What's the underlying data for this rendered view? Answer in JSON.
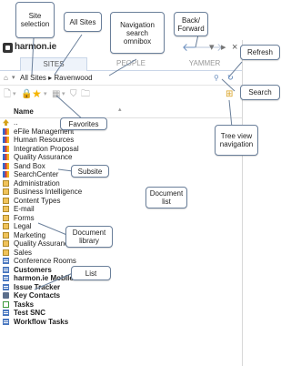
{
  "app": {
    "logo_text": "harmon.ie"
  },
  "window_controls": {
    "back": "🡐",
    "forward": "🡒",
    "menu": "▾",
    "pin": "▸",
    "close": "×"
  },
  "tabs": [
    {
      "label": "SITES",
      "active": true
    },
    {
      "label": "PEOPLE",
      "active": false
    },
    {
      "label": "YAMMER",
      "active": false
    }
  ],
  "address_bar": {
    "path": "All Sites ▸ Ravenwood",
    "refresh_symbol": "↻",
    "search_symbol": "⚲"
  },
  "list": {
    "column_header": "Name",
    "items": [
      {
        "name": "..",
        "icon": "up-folder-icon"
      },
      {
        "name": "eFile Management",
        "icon": "site-icon"
      },
      {
        "name": "Human Resources",
        "icon": "site-icon"
      },
      {
        "name": "Integration Proposal",
        "icon": "site-icon"
      },
      {
        "name": "Quality Assurance",
        "icon": "site-icon"
      },
      {
        "name": "Sand Box",
        "icon": "site-icon"
      },
      {
        "name": "SearchCenter",
        "icon": "site-icon"
      },
      {
        "name": "Administration",
        "icon": "library-icon"
      },
      {
        "name": "Business Intelligence",
        "icon": "library-icon"
      },
      {
        "name": "Content Types",
        "icon": "library-icon"
      },
      {
        "name": "E-mail",
        "icon": "library-icon"
      },
      {
        "name": "Forms",
        "icon": "library-icon"
      },
      {
        "name": "Legal",
        "icon": "library-icon"
      },
      {
        "name": "Marketing",
        "icon": "library-icon"
      },
      {
        "name": "Quality Assurance",
        "icon": "library-icon"
      },
      {
        "name": "Sales",
        "icon": "library-icon"
      },
      {
        "name": "Conference Rooms",
        "icon": "list-icon"
      },
      {
        "name": "Customers",
        "icon": "list-icon",
        "strong": true
      },
      {
        "name": "harmon.ie Mobile Users",
        "icon": "list-icon",
        "strong": true
      },
      {
        "name": "Issue Tracker",
        "icon": "list-icon",
        "strong": true
      },
      {
        "name": "Key Contacts",
        "icon": "contact-icon",
        "strong": true
      },
      {
        "name": "Tasks",
        "icon": "task-icon",
        "strong": true
      },
      {
        "name": "Test SNC",
        "icon": "list-icon",
        "strong": true
      },
      {
        "name": "Workflow Tasks",
        "icon": "list-icon",
        "strong": true
      }
    ]
  },
  "callouts": {
    "site_selection": "Site selection",
    "all_sites": "All Sites",
    "nav_omnibox": "Navigation search omnibox",
    "back_forward": "Back/ Forward",
    "refresh": "Refresh",
    "search": "Search",
    "favorites": "Favorites",
    "tree_view": "Tree view navigation",
    "subsite": "Subsite",
    "document_list": "Document list",
    "document_library": "Document library",
    "list": "List"
  },
  "colors": {
    "accent": "#6b8fbf",
    "callout_border": "#6a7f9a",
    "site_icon": [
      "#2f6ad0",
      "#d83b3b",
      "#f2b31b"
    ],
    "library_icon": "#f0c35a",
    "favorite_star": "#f5b400"
  }
}
